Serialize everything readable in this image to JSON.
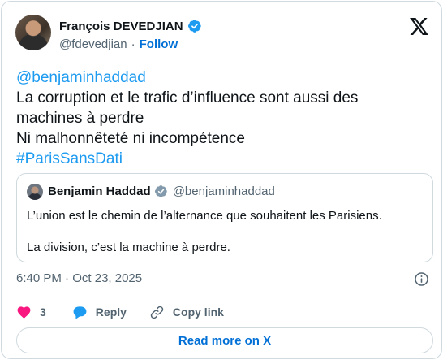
{
  "author": {
    "display_name": "François DEVEDJIAN",
    "handle": "@fdevedjian",
    "separator": "·",
    "follow_label": "Follow"
  },
  "tweet": {
    "lines": [
      "@benjaminhaddad",
      "La corruption et le trafic d’influence sont aussi des",
      "machines à perdre",
      "Ni malhonnêteté ni incompétence",
      "#ParisSansDati"
    ]
  },
  "quote": {
    "display_name": "Benjamin Haddad",
    "handle": "@benjaminhaddad",
    "paragraph1": "L’union est le chemin de l’alternance que souhaitent les Parisiens.",
    "paragraph2": "La division, c’est la machine à perdre."
  },
  "meta": {
    "time": "6:40 PM",
    "separator": "·",
    "date": "Oct 23, 2025"
  },
  "actions": {
    "like_count": "3",
    "reply_label": "Reply",
    "copy_link_label": "Copy link"
  },
  "read_more_label": "Read more on X",
  "icons": {
    "verified": "verified-badge-icon",
    "x_logo": "x-logo-icon",
    "info": "info-icon",
    "like": "heart-icon",
    "reply": "speech-bubble-icon",
    "copy_link": "link-icon"
  },
  "colors": {
    "link": "#1d9bf0",
    "follow": "#006fd6",
    "like": "#f91880",
    "reply": "#1d9bf0",
    "secondary_text": "#536471",
    "border": "#cfd9de"
  }
}
